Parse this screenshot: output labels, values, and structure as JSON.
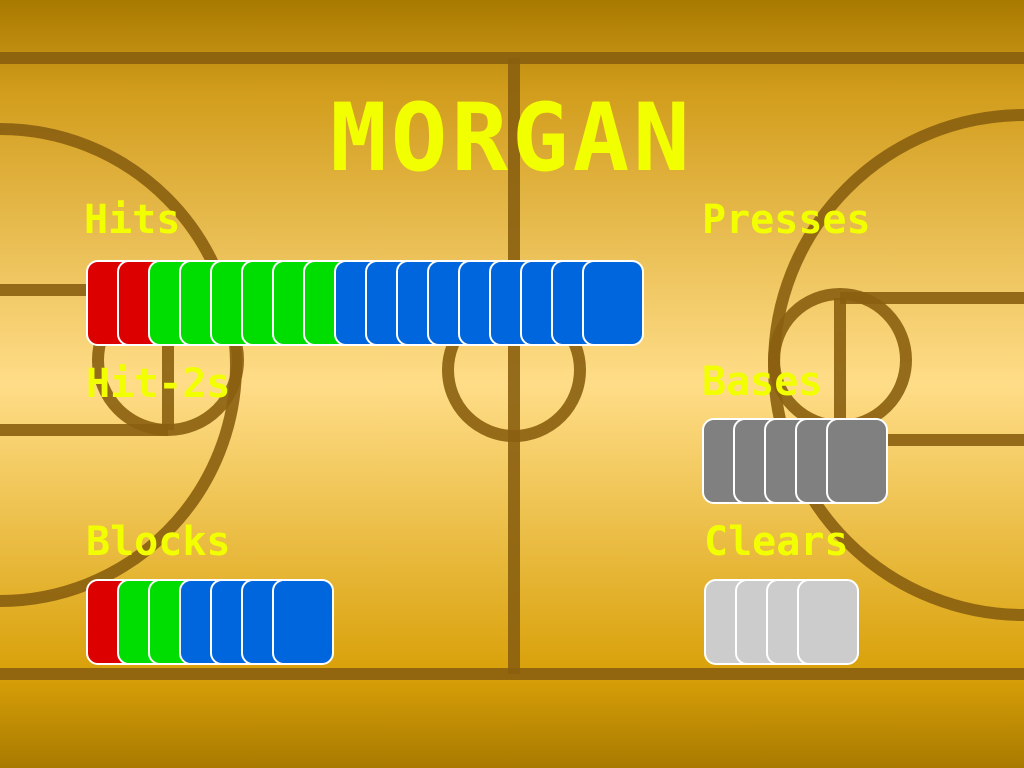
{
  "player": {
    "name": "MORGAN"
  },
  "colors": {
    "title": "#f2ff00",
    "label": "#f2ff00",
    "court_lines": "#8a5f10",
    "red": "#dd0000",
    "green": "#00dd00",
    "blue": "#0066dd",
    "dark_gray": "#808080",
    "light_gray": "#cccccc"
  },
  "stats": {
    "hits": {
      "label": "Hits",
      "red": 2,
      "green": 6,
      "blue": 9,
      "chip_color": ""
    },
    "hit2s": {
      "label": "Hit-2s",
      "red": 0,
      "green": 0,
      "blue": 0,
      "chip_color": ""
    },
    "blocks": {
      "label": "Blocks",
      "red": 1,
      "green": 2,
      "blue": 4,
      "chip_color": ""
    },
    "presses": {
      "label": "Presses",
      "count": 0,
      "chip_color": "#808080"
    },
    "bases": {
      "label": "Bases",
      "count": 5,
      "chip_color": "#808080"
    },
    "clears": {
      "label": "Clears",
      "count": 4,
      "chip_color": "#cccccc"
    }
  }
}
